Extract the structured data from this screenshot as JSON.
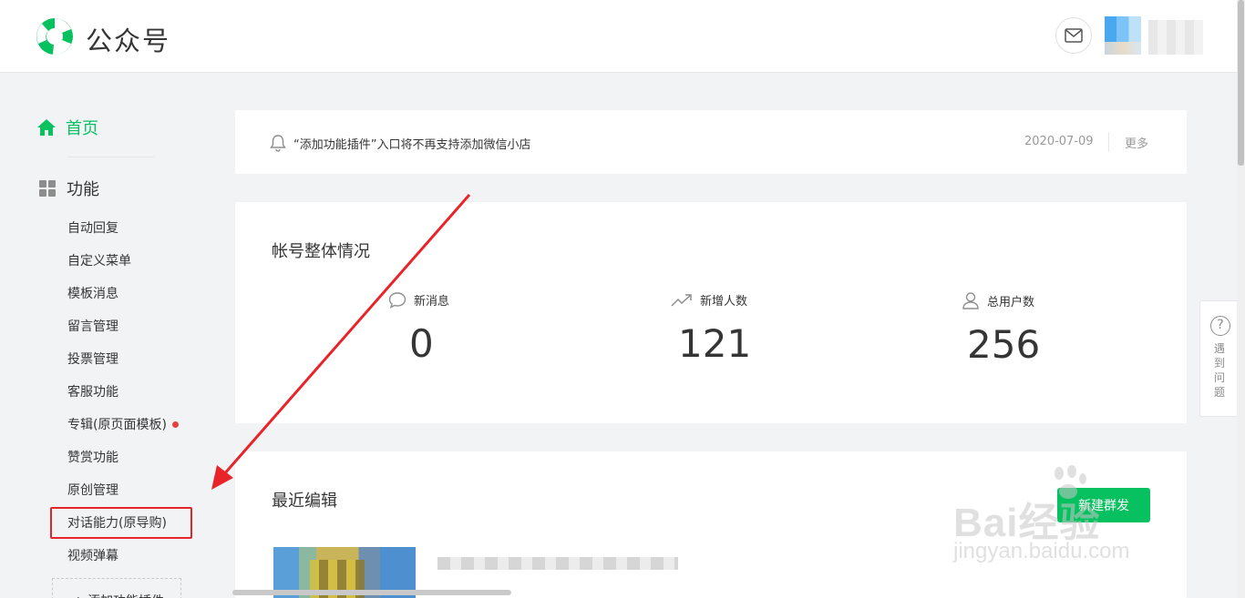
{
  "header": {
    "brand": "公众号",
    "mail_icon": "mail-icon",
    "accent_color": "#07c160"
  },
  "sidebar": {
    "home_label": "首页",
    "functions_label": "功能",
    "items": [
      {
        "label": "自动回复"
      },
      {
        "label": "自定义菜单"
      },
      {
        "label": "模板消息"
      },
      {
        "label": "留言管理"
      },
      {
        "label": "投票管理"
      },
      {
        "label": "客服功能"
      },
      {
        "label": "专辑(原页面模板)",
        "badge": "red-dot"
      },
      {
        "label": "赞赏功能"
      },
      {
        "label": "原创管理"
      },
      {
        "label": "对话能力(原导购)",
        "highlighted": true
      },
      {
        "label": "视频弹幕"
      }
    ],
    "add_plugin_label": "+ 添加功能插件"
  },
  "notice": {
    "text": "“添加功能插件”入口将不再支持添加微信小店",
    "date": "2020-07-09",
    "more_label": "更多"
  },
  "overview": {
    "title": "帐号整体情况",
    "stats": [
      {
        "label": "新消息",
        "value": "0",
        "icon": "chat-bubble-icon"
      },
      {
        "label": "新增人数",
        "value": "121",
        "icon": "trend-up-icon"
      },
      {
        "label": "总用户数",
        "value": "256",
        "icon": "user-icon"
      }
    ]
  },
  "recent": {
    "title": "最近编辑",
    "new_button_label": "新建群发"
  },
  "help": {
    "label": "遇到问题"
  },
  "watermark": {
    "main": "Bai经验",
    "sub": "jingyan.baidu.com"
  },
  "annotation": {
    "highlight_color": "#e8242a"
  }
}
